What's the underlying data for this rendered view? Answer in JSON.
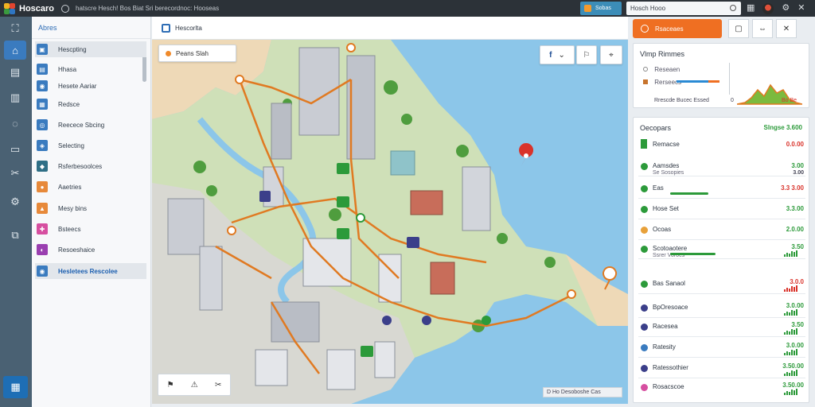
{
  "app": {
    "title": "Hoscaro",
    "subtitle": "hatscre Hesch! Bos Biat Sri berecordnoc: Hooseas",
    "pill_label": "Sobas",
    "search_value": "Hosch Hooo"
  },
  "colors": {
    "accent_blue": "#3a7bbf",
    "accent_orange": "#ef6f22",
    "positive_green": "#2c9a3a",
    "negative_red": "#d9332b",
    "water": "#8cc6e9",
    "route": "#e07a22"
  },
  "rail": {
    "icons": [
      "map-icon",
      "home-icon",
      "grid-icon",
      "chart-icon",
      "compass-icon",
      "card-icon",
      "tools-icon",
      "settings-icon",
      "layers-icon",
      "calendar-icon"
    ]
  },
  "sidebar": {
    "header": "Abres",
    "items": [
      {
        "label": "Hescpting",
        "chip_color": "#3a7bbf",
        "chip_glyph": "▣"
      },
      {
        "label": "Hhasa",
        "chip_color": "#3a7bbf",
        "chip_glyph": "▤"
      },
      {
        "label": "Hesete Aariar",
        "chip_color": "#3a7bbf",
        "chip_glyph": "◉"
      },
      {
        "label": "Redsce",
        "chip_color": "#3a7bbf",
        "chip_glyph": "▦"
      },
      {
        "label": "Reecece Sbcing",
        "chip_color": "#3a7bbf",
        "chip_glyph": "◎"
      },
      {
        "label": "Selecting",
        "chip_color": "#3a7bbf",
        "chip_glyph": "◈"
      },
      {
        "label": "Rsferbesoolces",
        "chip_color": "#2f6f86",
        "chip_glyph": "◆"
      },
      {
        "label": "Aaetries",
        "chip_color": "#e7893a",
        "chip_glyph": "●"
      },
      {
        "label": "Mesy bins",
        "chip_color": "#e7893a",
        "chip_glyph": "▲"
      },
      {
        "label": "Bsteecs",
        "chip_color": "#d64fa0",
        "chip_glyph": "✚"
      },
      {
        "label": "Resoeshaice",
        "chip_color": "#9a3fb0",
        "chip_glyph": "◐"
      },
      {
        "label": "Hesletees Rescolee",
        "chip_color": "#3a7bbf",
        "chip_glyph": "◉"
      }
    ]
  },
  "map_panel": {
    "title": "Hescorlta",
    "search_placeholder": "Peans Slah",
    "controls": [
      "f",
      "⌄",
      "⚐",
      "⌖"
    ],
    "tools": [
      "⚑",
      "⚠",
      "✂"
    ],
    "footer": "D Ho Desoboshe Cas"
  },
  "right_panel": {
    "primary_button": "Rsaceaes",
    "toolbar_icons": [
      "clipboard-icon",
      "expand-icon",
      "close-icon"
    ],
    "summary": {
      "title": "Vlmp Rimmes",
      "rows": [
        {
          "label": "Reseaen"
        },
        {
          "label": "Rerseecs"
        }
      ],
      "axis_left": "Rrescde Bucec Essed",
      "axis_mid": "0",
      "axis_right": "Bo Be"
    },
    "detail": {
      "title": "Oecopars",
      "title_value": "Slngse 3.600",
      "first": {
        "label": "Remacse",
        "value": "0.0.00"
      },
      "rows": [
        {
          "label": "Aamsdes",
          "sub": "Se Sosopies",
          "value": "3.00",
          "val2": "3.00",
          "color": "#2c9a3a"
        },
        {
          "label": "Eas",
          "value": "3.3 3.00",
          "color": "#d9332b",
          "progress": 0.8
        },
        {
          "label": "Hose Set",
          "value": "3.3.00",
          "color": "#2c9a3a"
        },
        {
          "label": "Ocoas",
          "value": "2.0.00",
          "color": "#2c9a3a"
        },
        {
          "label": "Scotoaotere",
          "sub": "Ssrer Vorocs",
          "value": "3.50",
          "color": "#2c9a3a",
          "progress": 0.95
        },
        {
          "label": "Bas Sanaol",
          "value": "3.0.0",
          "color": "#d9332b"
        },
        {
          "label": "BpOresoace",
          "value": "3.0.00",
          "color": "#2c9a3a"
        },
        {
          "label": "Racesea",
          "value": "3.50",
          "color": "#2c9a3a"
        },
        {
          "label": "Ratesity",
          "value": "3.0.00",
          "color": "#2c9a3a"
        },
        {
          "label": "Ratessothier",
          "value": "3.50.00",
          "color": "#2c9a3a"
        },
        {
          "label": "Rosacscoe",
          "value": "3.50.00",
          "color": "#2c9a3a"
        }
      ]
    }
  }
}
